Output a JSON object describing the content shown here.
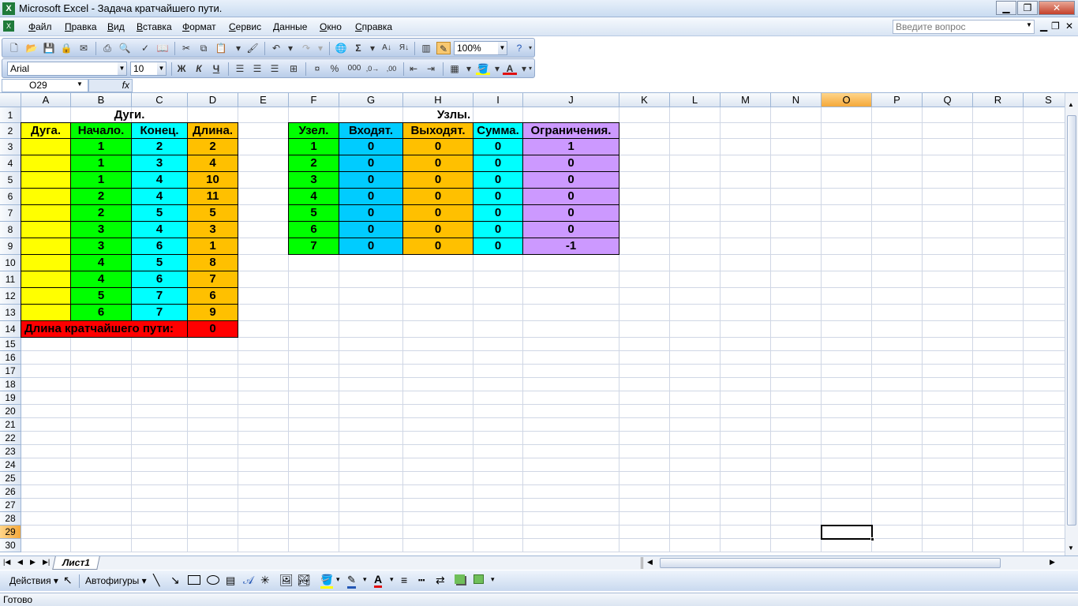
{
  "window": {
    "title": "Microsoft Excel - Задача кратчайшего пути.",
    "minimize": "▁",
    "restore": "❐",
    "close": "✕"
  },
  "menu": [
    "Файл",
    "Правка",
    "Вид",
    "Вставка",
    "Формат",
    "Сервис",
    "Данные",
    "Окно",
    "Справка"
  ],
  "help_box": {
    "placeholder": "Введите вопрос"
  },
  "toolbar": {
    "zoom": "100%",
    "font_name": "Arial",
    "font_size": "10",
    "bold": "Ж",
    "italic": "К",
    "underline": "Ч",
    "percent": "%",
    "thousands": "000"
  },
  "formula_bar": {
    "name_box": "O29",
    "fx": "fx",
    "content": ""
  },
  "columns": [
    "A",
    "B",
    "C",
    "D",
    "E",
    "F",
    "G",
    "H",
    "I",
    "J",
    "K",
    "L",
    "M",
    "N",
    "O",
    "P",
    "Q",
    "R",
    "S"
  ],
  "rows": [
    "1",
    "2",
    "3",
    "4",
    "5",
    "6",
    "7",
    "8",
    "9",
    "10",
    "11",
    "12",
    "13",
    "14",
    "15",
    "16",
    "17",
    "18",
    "19",
    "20",
    "21",
    "22",
    "23",
    "24",
    "25",
    "26",
    "27",
    "28",
    "29",
    "30"
  ],
  "selected_cell": {
    "column": "O",
    "row": "29"
  },
  "arcs_table": {
    "title": "Дуги.",
    "headers": [
      "Дуга.",
      "Начало.",
      "Конец.",
      "Длина."
    ],
    "rows": [
      [
        "",
        "1",
        "2",
        "2"
      ],
      [
        "",
        "1",
        "3",
        "4"
      ],
      [
        "",
        "1",
        "4",
        "10"
      ],
      [
        "",
        "2",
        "4",
        "11"
      ],
      [
        "",
        "2",
        "5",
        "5"
      ],
      [
        "",
        "3",
        "4",
        "3"
      ],
      [
        "",
        "3",
        "6",
        "1"
      ],
      [
        "",
        "4",
        "5",
        "8"
      ],
      [
        "",
        "4",
        "6",
        "7"
      ],
      [
        "",
        "5",
        "7",
        "6"
      ],
      [
        "",
        "6",
        "7",
        "9"
      ]
    ],
    "total_label": "Длина кратчайшего пути:",
    "total_value": "0",
    "colors": {
      "A": "#ffff00",
      "B": "#00ff00",
      "C": "#00ffff",
      "D": "#ffc000",
      "total": "#ff0000"
    }
  },
  "nodes_table": {
    "title": "Узлы.",
    "headers": [
      "Узел.",
      "Входят.",
      "Выходят.",
      "Сумма.",
      "Ограничения."
    ],
    "rows": [
      [
        "1",
        "0",
        "0",
        "0",
        "1"
      ],
      [
        "2",
        "0",
        "0",
        "0",
        "0"
      ],
      [
        "3",
        "0",
        "0",
        "0",
        "0"
      ],
      [
        "4",
        "0",
        "0",
        "0",
        "0"
      ],
      [
        "5",
        "0",
        "0",
        "0",
        "0"
      ],
      [
        "6",
        "0",
        "0",
        "0",
        "0"
      ],
      [
        "7",
        "0",
        "0",
        "0",
        "-1"
      ]
    ],
    "colors": {
      "F": "#00ff00",
      "G": "#00ccff",
      "H": "#ffc000",
      "I": "#00ffff",
      "J": "#cc99ff"
    }
  },
  "sheet_tabs": [
    "Лист1"
  ],
  "draw_toolbar": {
    "actions": "Действия",
    "autoshapes": "Автофигуры"
  },
  "status": "Готово"
}
